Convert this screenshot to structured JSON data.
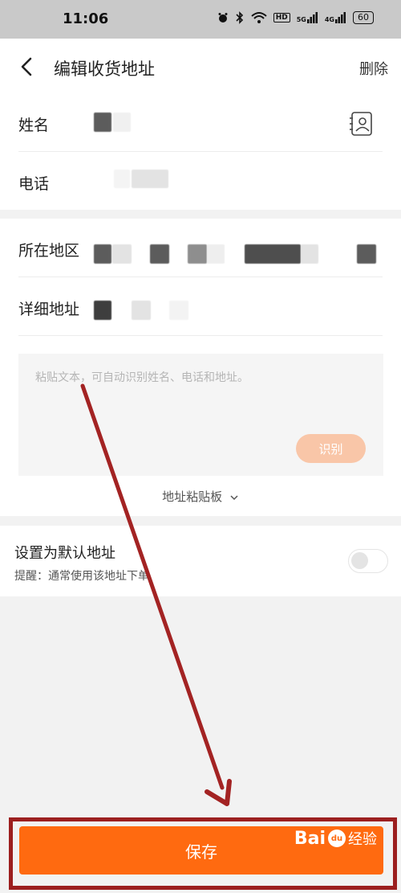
{
  "status_bar": {
    "time": "11:06",
    "icons": [
      "alarm-icon",
      "bluetooth-icon",
      "wifi-icon",
      "hd-icon",
      "signal-5g-icon",
      "signal-4g-icon"
    ],
    "hd_label": "HD",
    "net1": "5G",
    "net2": "4G",
    "battery": "60"
  },
  "header": {
    "title": "编辑收货地址",
    "delete_label": "删除"
  },
  "form": {
    "name_label": "姓名",
    "phone_label": "电话",
    "region_label": "所在地区",
    "detail_label": "详细地址"
  },
  "paste": {
    "placeholder": "粘贴文本，可自动识别姓名、电话和地址。",
    "recognize_label": "识别",
    "clipboard_label": "地址粘贴板"
  },
  "default_setting": {
    "title": "设置为默认地址",
    "hint": "提醒：通常使用该地址下单",
    "enabled": false
  },
  "footer": {
    "save_label": "保存"
  },
  "watermark": {
    "bai": "Bai",
    "du": "du",
    "jingyan": "经验"
  },
  "colors": {
    "accent": "#ff6a10",
    "recognize_disabled": "#f9c6a8",
    "annotation_arrow": "#a32323"
  }
}
